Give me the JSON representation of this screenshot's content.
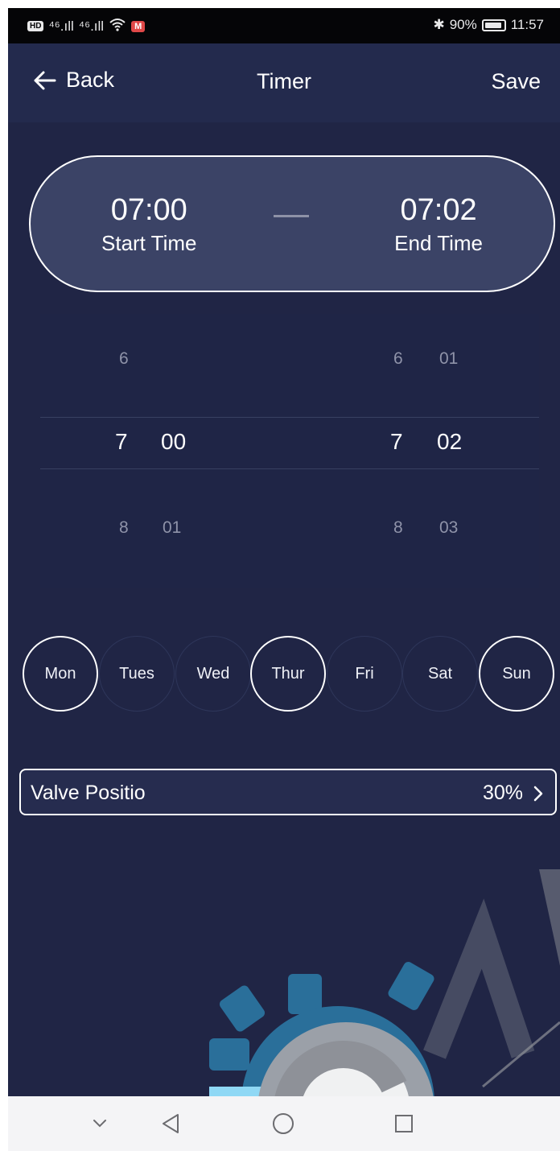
{
  "status_bar": {
    "left_badge": "HD",
    "signal_1": "⁴⁶.ıll",
    "signal_2": "⁴⁶.ıll",
    "bluetooth": "✱",
    "battery": "90%",
    "time": "11:57",
    "battery_level": 0.9
  },
  "header": {
    "back_label": "Back",
    "title": "Timer",
    "save_label": "Save"
  },
  "time_range": {
    "start_time": "07:00",
    "start_label": "Start Time",
    "end_time": "07:02",
    "end_label": "End Time"
  },
  "picker": {
    "start_hours": [
      "6",
      "7",
      "8"
    ],
    "start_minutes": [
      "",
      "00",
      "01"
    ],
    "end_hours": [
      "6",
      "7",
      "8"
    ],
    "end_minutes": [
      "01",
      "02",
      "03"
    ]
  },
  "weekdays": [
    {
      "label": "Mon",
      "selected": true
    },
    {
      "label": "Tues",
      "selected": false
    },
    {
      "label": "Wed",
      "selected": false
    },
    {
      "label": "Thur",
      "selected": true
    },
    {
      "label": "Fri",
      "selected": false
    },
    {
      "label": "Sat",
      "selected": false
    },
    {
      "label": "Sun",
      "selected": true
    }
  ],
  "valve": {
    "label": "Valve Positio",
    "value": "30%"
  },
  "colors": {
    "background": "#202545",
    "header": "#232a4d",
    "capsule": "#3b4366",
    "text": "#ffffff",
    "muted_text": "#8f93a9",
    "watermark_gear": "#2a6f9a",
    "watermark_light": "#8fd8f5"
  },
  "icons": {
    "back": "arrow-left-icon",
    "chevron": "chevron-right-icon",
    "sys_nav": [
      "chevron-down-icon",
      "back-triangle-icon",
      "home-circle-icon",
      "recent-square-icon"
    ]
  }
}
